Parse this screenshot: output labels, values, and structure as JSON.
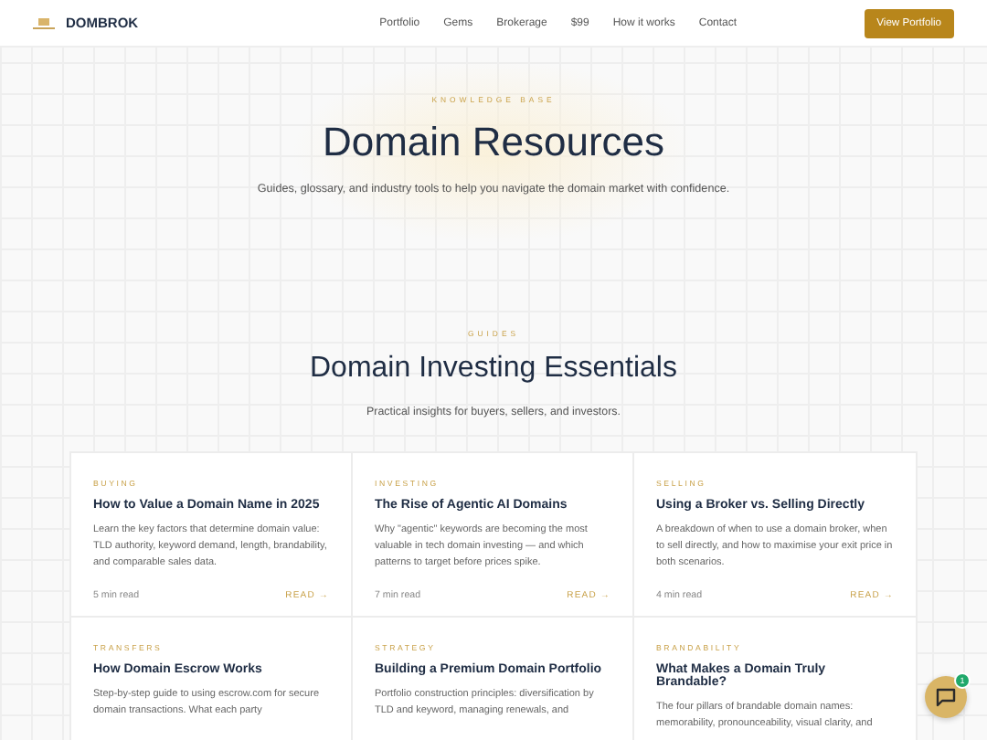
{
  "header": {
    "brand": "DOMBROK",
    "nav": [
      "Portfolio",
      "Gems",
      "Brokerage",
      "$99",
      "How it works",
      "Contact"
    ],
    "cta": "View Portfolio"
  },
  "hero": {
    "eyebrow": "KNOWLEDGE BASE",
    "title": "Domain Resources",
    "subtitle": "Guides, glossary, and industry tools to help you navigate the domain market with confidence."
  },
  "section": {
    "eyebrow": "GUIDES",
    "title": "Domain Investing Essentials",
    "subtitle": "Practical insights for buyers, sellers, and investors."
  },
  "cards": [
    {
      "category": "BUYING",
      "title": "How to Value a Domain Name in 2025",
      "text": "Learn the key factors that determine domain value: TLD authority, keyword demand, length, brandability, and comparable sales data.",
      "read_time": "5 min read",
      "link": "READ →"
    },
    {
      "category": "INVESTING",
      "title": "The Rise of Agentic AI Domains",
      "text": "Why \"agentic\" keywords are becoming the most valuable in tech domain investing — and which patterns to target before prices spike.",
      "read_time": "7 min read",
      "link": "READ →"
    },
    {
      "category": "SELLING",
      "title": "Using a Broker vs. Selling Directly",
      "text": "A breakdown of when to use a domain broker, when to sell directly, and how to maximise your exit price in both scenarios.",
      "read_time": "4 min read",
      "link": "READ →"
    },
    {
      "category": "TRANSFERS",
      "title": "How Domain Escrow Works",
      "text": "Step-by-step guide to using escrow.com for secure domain transactions. What each party"
    },
    {
      "category": "STRATEGY",
      "title": "Building a Premium Domain Portfolio",
      "text": "Portfolio construction principles: diversification by TLD and keyword, managing renewals, and"
    },
    {
      "category": "BRANDABILITY",
      "title": "What Makes a Domain Truly Brandable?",
      "text": "The four pillars of brandable domain names: memorability, pronounceability, visual clarity, and"
    }
  ],
  "chat": {
    "badge": "1"
  }
}
